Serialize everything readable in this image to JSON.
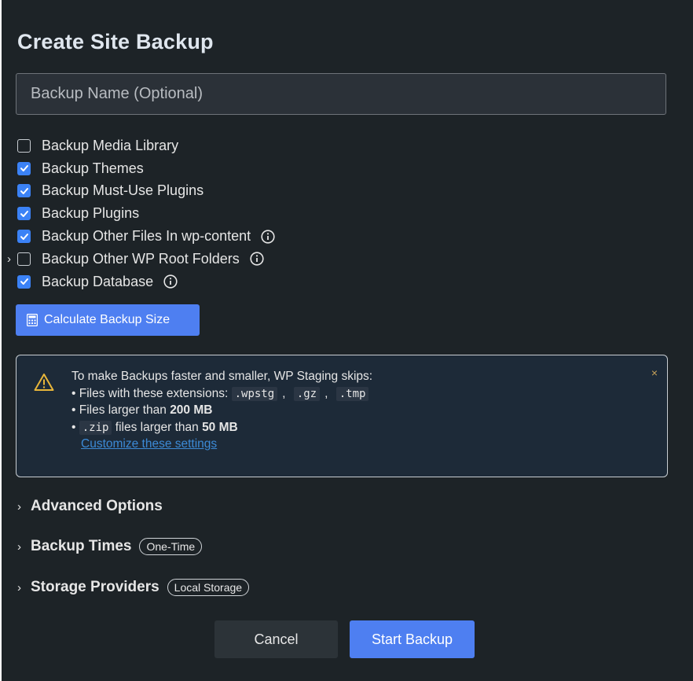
{
  "dialog": {
    "title": "Create Site Backup",
    "name_placeholder": "Backup Name (Optional)",
    "name_value": ""
  },
  "options": [
    {
      "label": "Backup Media Library",
      "checked": false,
      "info": false
    },
    {
      "label": "Backup Themes",
      "checked": true,
      "info": false
    },
    {
      "label": "Backup Must-Use Plugins",
      "checked": true,
      "info": false
    },
    {
      "label": "Backup Plugins",
      "checked": true,
      "info": false
    },
    {
      "label": "Backup Other Files In wp-content",
      "checked": true,
      "info": true
    },
    {
      "label": "Backup Other WP Root Folders",
      "checked": false,
      "info": true,
      "expandable": true
    },
    {
      "label": "Backup Database",
      "checked": true,
      "info": true
    }
  ],
  "calculate_button": {
    "label": "Calculate Backup Size",
    "icon": "calculator-icon"
  },
  "notice": {
    "intro": "To make Backups faster and smaller, WP Staging skips:",
    "extensions_label": "• Files with these extensions:",
    "extensions": [
      ".wpstg",
      ".gz",
      ".tmp"
    ],
    "large_files_prefix": "• Files larger than ",
    "large_files_size": "200 MB",
    "zip_bullet": "•",
    "zip_ext": ".zip",
    "zip_middle": " files larger than ",
    "zip_size": "50 MB",
    "link": "Customize these settings",
    "close": "×",
    "icon": "warning-icon"
  },
  "sections": {
    "advanced": {
      "label": "Advanced Options"
    },
    "times": {
      "label": "Backup Times",
      "pill": "One-Time"
    },
    "storage": {
      "label": "Storage Providers",
      "pill": "Local Storage"
    }
  },
  "footer": {
    "cancel": "Cancel",
    "start": "Start Backup"
  },
  "colors": {
    "accent": "#4e7ff1",
    "background": "#1d2327",
    "link": "#3c8ad6",
    "warning": "#e8b63a"
  }
}
